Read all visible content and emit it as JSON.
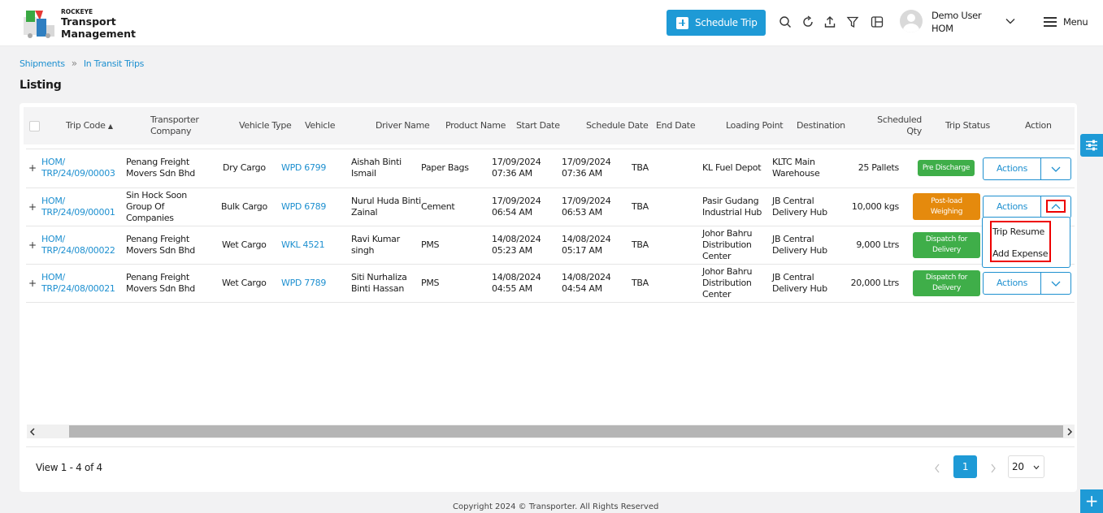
{
  "header": {
    "brand_small": "ROCKEYE",
    "brand_line1": "Transport",
    "brand_line2": "Management",
    "schedule_label": "Schedule Trip",
    "user_name": "Demo User",
    "user_org": "HOM",
    "menu_label": "Menu"
  },
  "breadcrumb": {
    "item1": "Shipments",
    "item2": "In Transit Trips"
  },
  "page_title": "Listing",
  "table": {
    "columns": {
      "trip_code": "Trip Code",
      "transporter_company_1": "Transporter",
      "transporter_company_2": "Company",
      "vehicle_type": "Vehicle Type",
      "vehicle": "Vehicle",
      "driver_name": "Driver Name",
      "product_name": "Product Name",
      "start_date": "Start Date",
      "schedule_date": "Schedule Date",
      "end_date": "End Date",
      "loading_point": "Loading Point",
      "destination": "Destination",
      "scheduled_qty_1": "Scheduled",
      "scheduled_qty_2": "Qty",
      "trip_status": "Trip Status",
      "action": "Action"
    },
    "rows": [
      {
        "expand": "+",
        "code1": "HOM/",
        "code2": "TRP/24/09/00003",
        "company1": "Penang Freight",
        "company2": "Movers Sdn Bhd",
        "company3": "",
        "vehicle_type": "Dry Cargo",
        "vehicle": "WPD 6799",
        "driver1": "Aishah Binti",
        "driver2": "Ismail",
        "product": "Paper Bags",
        "start1": "17/09/2024",
        "start2": "07:36 AM",
        "sched1": "17/09/2024",
        "sched2": "07:36 AM",
        "end": "TBA",
        "loading1": "KL Fuel Depot",
        "loading2": "",
        "loading3": "",
        "dest1": "KLTC Main",
        "dest2": "Warehouse",
        "qty": "25 Pallets",
        "status1": "Pre Discharge",
        "status2": "",
        "action": "Actions"
      },
      {
        "expand": "+",
        "code1": "HOM/",
        "code2": "TRP/24/09/00001",
        "company1": "Sin Hock Soon",
        "company2": "Group Of",
        "company3": "Companies",
        "vehicle_type": "Bulk Cargo",
        "vehicle": "WPD 6789",
        "driver1": "Nurul Huda Binti",
        "driver2": "Zainal",
        "product": "Cement",
        "start1": "17/09/2024",
        "start2": "06:54 AM",
        "sched1": "17/09/2024",
        "sched2": "06:53 AM",
        "end": "TBA",
        "loading1": "Pasir Gudang",
        "loading2": "Industrial Hub",
        "loading3": "",
        "dest1": "JB Central",
        "dest2": "Delivery Hub",
        "qty": "10,000 kgs",
        "status1": "Post-load",
        "status2": "Weighing",
        "action": "Actions"
      },
      {
        "expand": "+",
        "code1": "HOM/",
        "code2": "TRP/24/08/00022",
        "company1": "Penang Freight",
        "company2": "Movers Sdn Bhd",
        "company3": "",
        "vehicle_type": "Wet Cargo",
        "vehicle": "WKL 4521",
        "driver1": "Ravi Kumar",
        "driver2": "singh",
        "product": "PMS",
        "start1": "14/08/2024",
        "start2": "05:23 AM",
        "sched1": "14/08/2024",
        "sched2": "05:17 AM",
        "end": "TBA",
        "loading1": "Johor Bahru",
        "loading2": "Distribution",
        "loading3": "Center",
        "dest1": "JB Central",
        "dest2": "Delivery Hub",
        "qty": "9,000 Ltrs",
        "status1": "Dispatch for",
        "status2": "Delivery",
        "action": "Actions"
      },
      {
        "expand": "+",
        "code1": "HOM/",
        "code2": "TRP/24/08/00021",
        "company1": "Penang Freight",
        "company2": "Movers Sdn Bhd",
        "company3": "",
        "vehicle_type": "Wet Cargo",
        "vehicle": "WPD 7789",
        "driver1": "Siti Nurhaliza",
        "driver2": "Binti Hassan",
        "product": "PMS",
        "start1": "14/08/2024",
        "start2": "04:55 AM",
        "sched1": "14/08/2024",
        "sched2": "04:54 AM",
        "end": "TBA",
        "loading1": "Johor Bahru",
        "loading2": "Distribution",
        "loading3": "Center",
        "dest1": "JB Central",
        "dest2": "Delivery Hub",
        "qty": "20,000 Ltrs",
        "status1": "Dispatch for",
        "status2": "Delivery",
        "action": "Actions"
      }
    ]
  },
  "dropdown": {
    "item1": "Trip Resume",
    "item2": "Add Expense"
  },
  "footer": {
    "view_info": "View 1 - 4 of 4",
    "current_page": "1",
    "page_size": "20",
    "copyright": "Copyright 2024 © Transporter. All Rights Reserved"
  },
  "colors": {
    "accent": "#1e9ad6",
    "link": "#1e90d0",
    "status_green": "#3fae49",
    "status_orange": "#e58a0d",
    "highlight": "#e00000"
  },
  "icons": [
    "search-icon",
    "refresh-icon",
    "upload-icon",
    "filter-icon",
    "columns-icon",
    "chevron-down-icon",
    "menu-icon",
    "sliders-icon",
    "plus-icon"
  ]
}
